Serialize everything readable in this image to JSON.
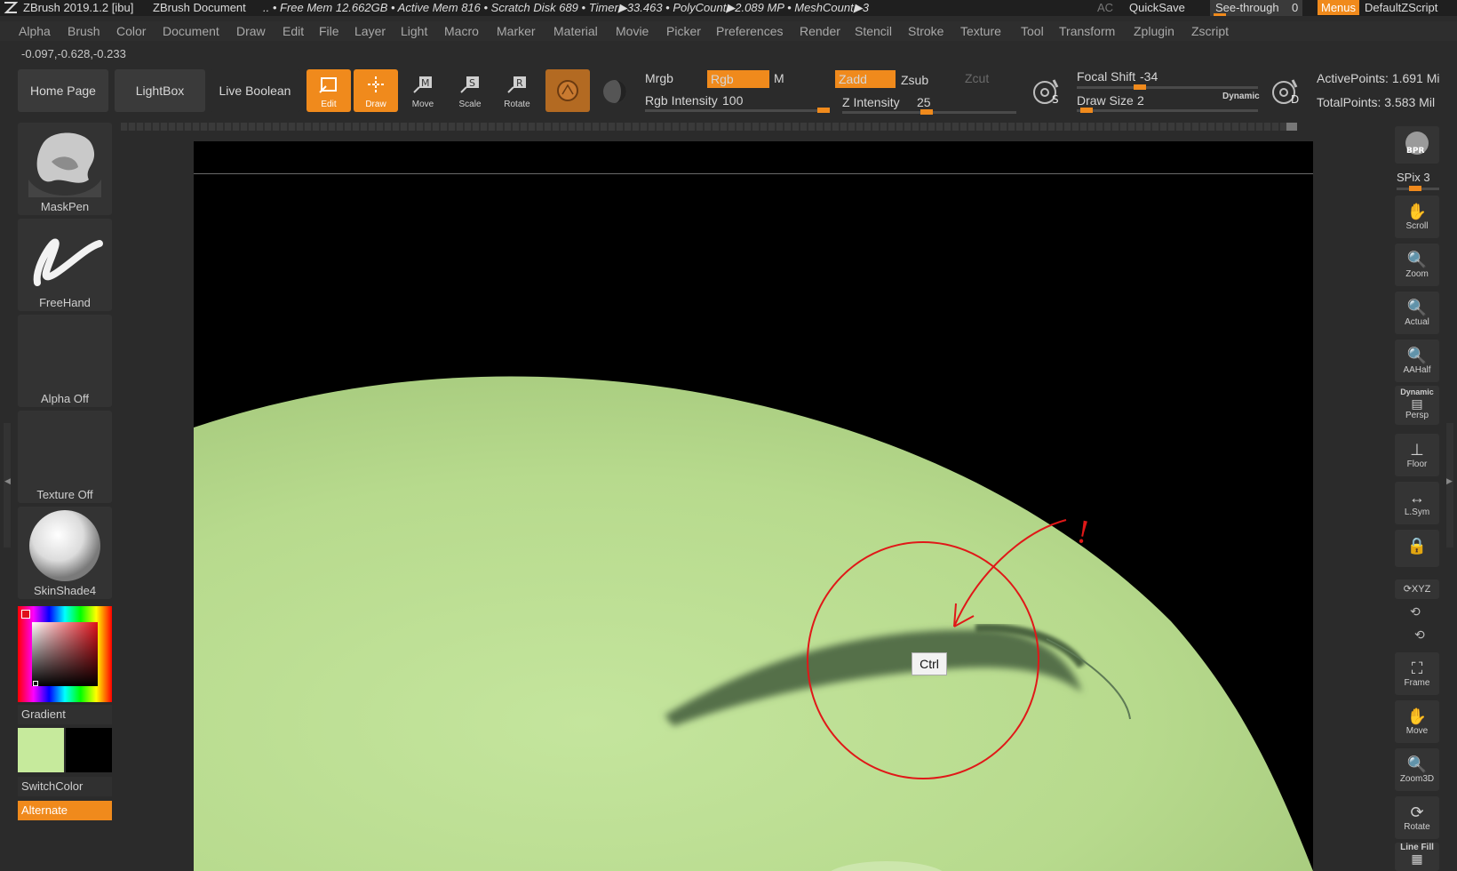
{
  "titlebar": {
    "app": "ZBrush 2019.1.2 [ibu]",
    "document": "ZBrush Document",
    "stats": ".. • Free Mem 12.662GB • Active Mem 816 • Scratch Disk 689 • Timer▶33.463 • PolyCount▶2.089 MP • MeshCount▶3",
    "ac": "AC",
    "quicksave": "QuickSave",
    "see_through": "See-through",
    "see_through_value": "0",
    "menus": "Menus",
    "default_zscript": "DefaultZScript"
  },
  "menubar": [
    "Alpha",
    "Brush",
    "Color",
    "Document",
    "Draw",
    "Edit",
    "File",
    "Layer",
    "Light",
    "Macro",
    "Marker",
    "Material",
    "Movie",
    "Picker",
    "Preferences",
    "Render",
    "Stencil",
    "Stroke",
    "Texture",
    "Tool",
    "Transform",
    "Zplugin",
    "Zscript"
  ],
  "coords": "-0.097,-0.628,-0.233",
  "toolbar": {
    "home_page": "Home Page",
    "lightbox": "LightBox",
    "live_boolean": "Live Boolean",
    "edit": "Edit",
    "draw": "Draw",
    "move": "Move",
    "scale": "Scale",
    "rotate": "Rotate",
    "mrgb": "Mrgb",
    "rgb": "Rgb",
    "m": "M",
    "zadd": "Zadd",
    "zsub": "Zsub",
    "zcut": "Zcut",
    "rgb_intensity_label": "Rgb Intensity",
    "rgb_intensity_value": "100",
    "z_intensity_label": "Z Intensity",
    "z_intensity_value": "25",
    "focal_shift_label": "Focal Shift",
    "focal_shift_value": "-34",
    "draw_size_label": "Draw Size",
    "draw_size_value": "2",
    "dynamic": "Dynamic",
    "active_points": "ActivePoints: 1.691 Mi",
    "total_points": "TotalPoints: 3.583 Mil",
    "s_icon_letter": "S",
    "d_icon_letter": "D"
  },
  "left_shelf": {
    "brush": "MaskPen",
    "stroke": "FreeHand",
    "alpha": "Alpha Off",
    "texture": "Texture Off",
    "material": "SkinShade4",
    "gradient": "Gradient",
    "switch_color": "SwitchColor",
    "alternate": "Alternate"
  },
  "right_shelf": {
    "bpr": "BPR",
    "spix_label": "SPix",
    "spix_value": "3",
    "scroll": "Scroll",
    "zoom": "Zoom",
    "actual": "Actual",
    "aahalf": "AAHalf",
    "dynamic": "Dynamic",
    "persp": "Persp",
    "floor": "Floor",
    "lsym": "L.Sym",
    "xyz": "XYZ",
    "frame": "Frame",
    "move": "Move",
    "zoom3d": "Zoom3D",
    "rotate": "Rotate",
    "linefill": "Line Fill"
  },
  "canvas": {
    "key_hint": "Ctrl",
    "annotation_mark": "!"
  },
  "colors": {
    "accent": "#f08a1c",
    "model_green": "#b9dc8f",
    "primary_color": "#c6ea9c",
    "secondary_color": "#000000",
    "annotation_red": "#e01818"
  }
}
